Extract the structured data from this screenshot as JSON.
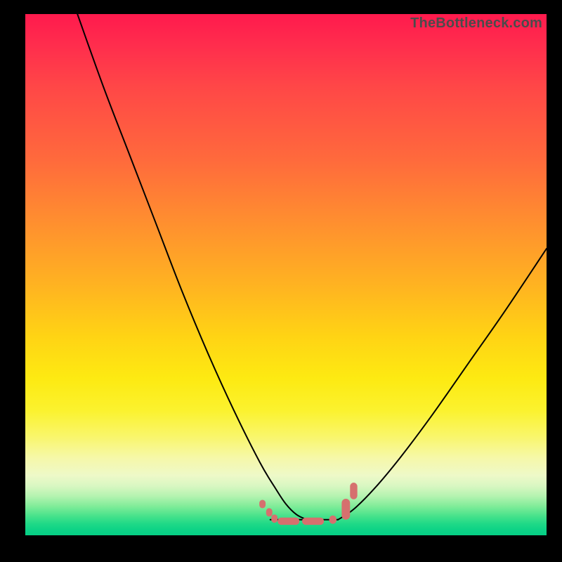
{
  "watermark": "TheBottleneck.com",
  "chart_data": {
    "type": "line",
    "title": "",
    "xlabel": "",
    "ylabel": "",
    "xlim": [
      0,
      100
    ],
    "ylim": [
      0,
      100
    ],
    "grid": false,
    "legend": false,
    "background_gradient": {
      "direction": "vertical",
      "stops": [
        {
          "pos": 0.0,
          "color": "#ff1a4d"
        },
        {
          "pos": 0.3,
          "color": "#ff7a36"
        },
        {
          "pos": 0.6,
          "color": "#ffd414"
        },
        {
          "pos": 0.82,
          "color": "#f9f66a"
        },
        {
          "pos": 0.9,
          "color": "#d9f7c2"
        },
        {
          "pos": 1.0,
          "color": "#05cf85"
        }
      ]
    },
    "series": [
      {
        "name": "left-branch",
        "color": "#000000",
        "x": [
          10,
          15,
          20,
          25,
          30,
          35,
          40,
          45,
          48,
          50,
          52,
          54
        ],
        "y": [
          100,
          86,
          73,
          60,
          47,
          35,
          24,
          14,
          9,
          6,
          4,
          3
        ]
      },
      {
        "name": "right-branch",
        "color": "#000000",
        "x": [
          60,
          63,
          67,
          72,
          78,
          85,
          92,
          100
        ],
        "y": [
          3,
          5,
          9,
          15,
          23,
          33,
          43,
          55
        ]
      },
      {
        "name": "valley-flat",
        "color": "#000000",
        "x": [
          47,
          60
        ],
        "y": [
          3,
          3
        ]
      }
    ],
    "markers": {
      "name": "bottom-dots",
      "color": "#d6706e",
      "shape": "rounded",
      "points": [
        {
          "x": 45.5,
          "y": 6.0,
          "w": 1.2,
          "h": 1.6
        },
        {
          "x": 46.8,
          "y": 4.4,
          "w": 1.2,
          "h": 1.6
        },
        {
          "x": 47.8,
          "y": 3.2,
          "w": 1.2,
          "h": 1.6
        },
        {
          "x": 50.5,
          "y": 2.7,
          "w": 4.2,
          "h": 1.4
        },
        {
          "x": 55.2,
          "y": 2.7,
          "w": 4.2,
          "h": 1.4
        },
        {
          "x": 59.0,
          "y": 3.0,
          "w": 1.4,
          "h": 1.6
        },
        {
          "x": 61.5,
          "y": 5.0,
          "w": 1.6,
          "h": 4.0
        },
        {
          "x": 63.0,
          "y": 8.5,
          "w": 1.4,
          "h": 3.2
        }
      ]
    }
  }
}
